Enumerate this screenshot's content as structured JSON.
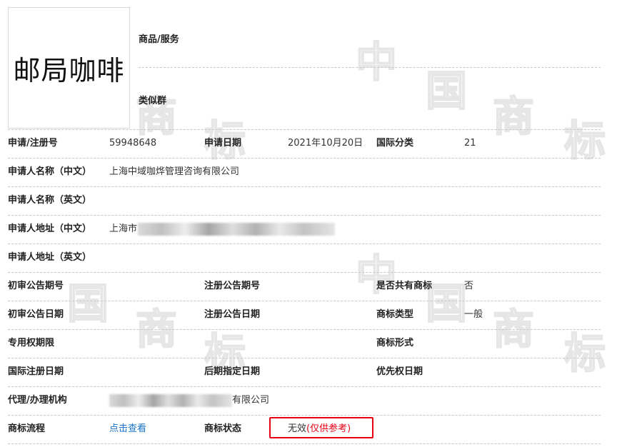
{
  "watermark": {
    "chars": [
      "中",
      "国",
      "商",
      "标"
    ]
  },
  "logo": {
    "text": "邮局咖啡"
  },
  "top": {
    "goods_label": "商品/服务",
    "similar_label": "类似群"
  },
  "fields": {
    "reg_no_label": "申请/注册号",
    "reg_no_value": "59948648",
    "apply_date_label": "申请日期",
    "apply_date_value": "2021年10月20日",
    "intl_class_label": "国际分类",
    "intl_class_value": "21",
    "applicant_cn_label": "申请人名称（中文）",
    "applicant_cn_value": "上海中域咖烨管理咨询有限公司",
    "applicant_en_label": "申请人名称（英文）",
    "address_cn_label": "申请人地址（中文）",
    "address_cn_value": "上海市",
    "address_en_label": "申请人地址（英文）",
    "prelim_issue_label": "初审公告期号",
    "reg_issue_label": "注册公告期号",
    "shared_label": "是否共有商标",
    "shared_value": "否",
    "prelim_date_label": "初审公告日期",
    "reg_date_label": "注册公告日期",
    "tm_type_label": "商标类型",
    "tm_type_value": "一般",
    "exclusive_label": "专用权期限",
    "tm_form_label": "商标形式",
    "intl_reg_date_label": "国际注册日期",
    "later_date_label": "后期指定日期",
    "priority_date_label": "优先权日期",
    "agent_label": "代理/办理机构",
    "agent_value": "有限公司",
    "process_label": "商标流程",
    "process_link": "点击查看",
    "status_label": "商标状态",
    "status_value": "无效",
    "status_note": "(仅供参考)"
  }
}
